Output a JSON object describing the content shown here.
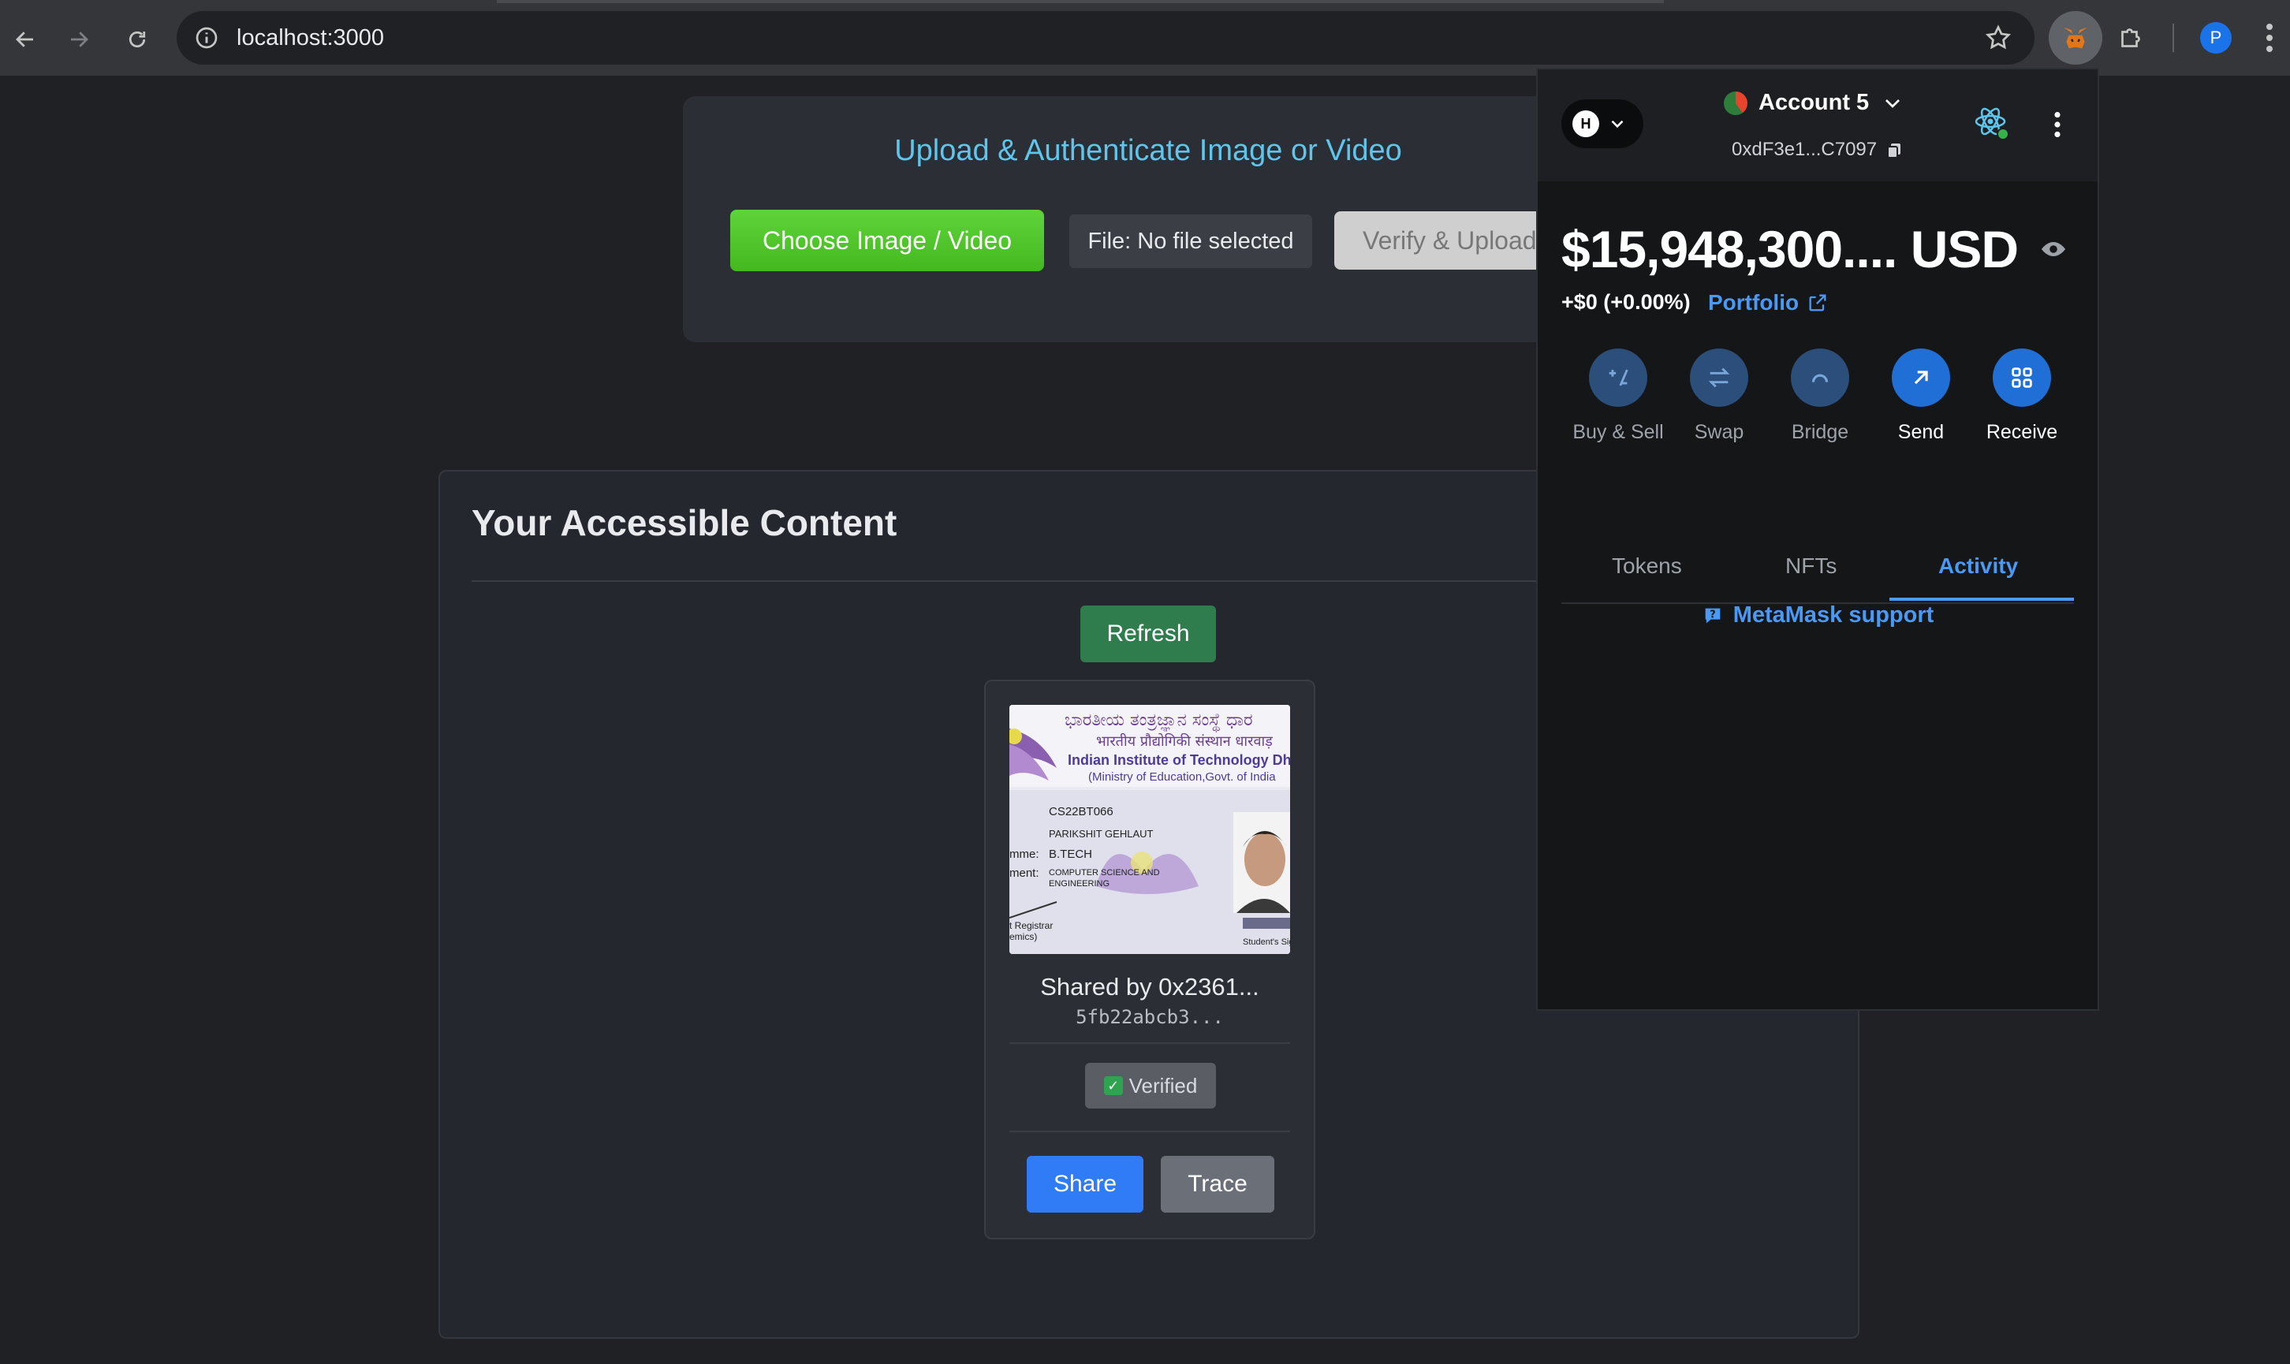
{
  "browser": {
    "url": "localhost:3000",
    "profile_initial": "P"
  },
  "upload": {
    "title": "Upload & Authenticate Image or Video",
    "choose_label": "Choose Image / Video",
    "file_label": "File: No file selected",
    "verify_label": "Verify & Upload"
  },
  "content": {
    "title": "Your Accessible Content",
    "refresh_label": "Refresh",
    "items": [
      {
        "shared_by": "Shared by 0x2361...",
        "hash": "5fb22abcb3...",
        "verified_label": "Verified",
        "share_label": "Share",
        "trace_label": "Trace",
        "thumbnail": {
          "header_kannada": "ಭಾರತೀಯ ತಂತ್ರಜ್ಞಾನ ಸಂಸ್ಥೆ ಧಾರ",
          "header_hindi": "भारतीय प्रौद्योगिकी संस्थान धारवाड़",
          "header_english": "Indian Institute of Technology Dha",
          "header_ministry": "(Ministry of Education,Govt. of India",
          "roll": "CS22BT066",
          "name": "PARIKSHIT GEHLAUT",
          "programme_label": "mme:",
          "programme": "B.TECH",
          "department_label": "ment:",
          "department_line1": "COMPUTER SCIENCE AND",
          "department_line2": "ENGINEERING",
          "registrar_line1": "t Registrar",
          "registrar_line2": "emics)",
          "student_sign": "Student's Sig"
        }
      }
    ]
  },
  "metamask": {
    "network_initial": "H",
    "account_name": "Account 5",
    "address": "0xdF3e1...C7097",
    "balance": "$15,948,300.... USD",
    "change": "+$0 (+0.00%)",
    "portfolio_label": "Portfolio",
    "actions": [
      {
        "label": "Buy & Sell",
        "icon": "plus-minus-icon"
      },
      {
        "label": "Swap",
        "icon": "swap-arrows-icon"
      },
      {
        "label": "Bridge",
        "icon": "bridge-arc-icon"
      },
      {
        "label": "Send",
        "icon": "arrow-up-right-icon"
      },
      {
        "label": "Receive",
        "icon": "qr-code-icon"
      }
    ],
    "tabs": [
      "Tokens",
      "NFTs",
      "Activity"
    ],
    "active_tab": "Activity",
    "support_label": "MetaMask support",
    "colors": {
      "accent": "#4a9af5",
      "action_active": "#1f6fd6",
      "action_inactive": "#2c4e7a"
    }
  }
}
